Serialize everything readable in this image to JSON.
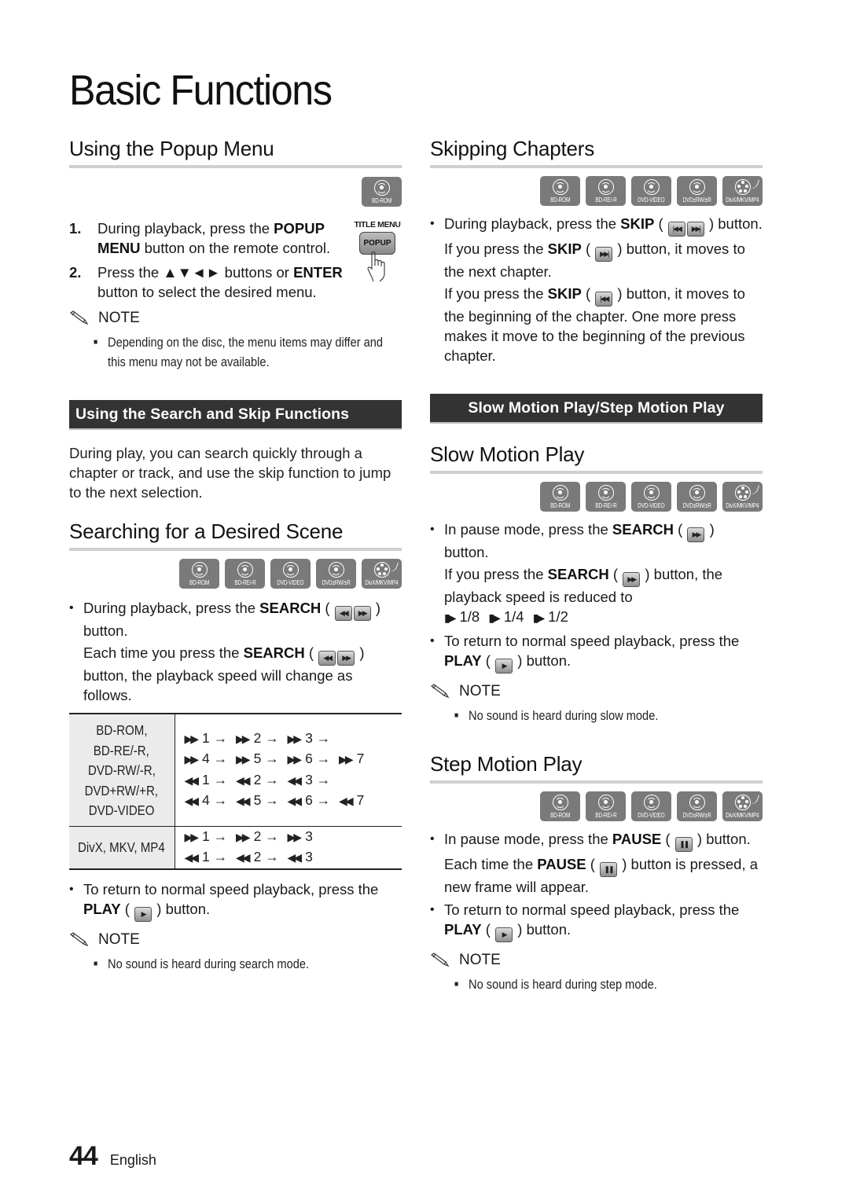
{
  "page": {
    "title": "Basic Functions",
    "page_number": "44",
    "language": "English"
  },
  "disc_badges": [
    "BD-ROM",
    "BD-RE/-R",
    "DVD-VIDEO",
    "DVD±RW/±R",
    "DivX/MKV/MP4"
  ],
  "popup_menu": {
    "heading": "Using the Popup Menu",
    "badge": "BD-ROM",
    "remote_art": {
      "top_label": "TITLE MENU",
      "button_label": "POPUP"
    },
    "steps": [
      {
        "num": "1.",
        "pre": "During playback, press the ",
        "bold": "POPUP MENU",
        "post": " button on the remote control."
      },
      {
        "num": "2.",
        "pre": "Press the ▲▼◄► buttons or ",
        "bold": "ENTER",
        "post": " button to select the desired menu."
      }
    ],
    "note_label": "NOTE",
    "note": "Depending on the disc, the menu items may differ and this menu may not be available."
  },
  "search_skip": {
    "bar_title": "Using the Search and Skip Functions",
    "intro": "During play, you can search quickly through a chapter or track, and use the skip function to jump to the next selection."
  },
  "searching": {
    "heading": "Searching for a Desired Scene",
    "bullet1": {
      "pre": "During playback, press the ",
      "bold": "SEARCH",
      "post": " button."
    },
    "sub1": {
      "pre": "Each time you press the ",
      "bold": "SEARCH",
      "post": " button, the playback speed will change as follows."
    },
    "table": {
      "rows": [
        {
          "discs": [
            "BD-ROM,",
            "BD-RE/-R,",
            "DVD-RW/-R,",
            "DVD+RW/+R,",
            "DVD-VIDEO"
          ],
          "sequences": [
            "1 → 2 → 3 →",
            "4 → 5 → 6 → 7",
            "1 → 2 → 3 →",
            "4 → 5 → 6 → 7"
          ],
          "directions": [
            "ff",
            "ff",
            "rew",
            "rew"
          ]
        },
        {
          "discs": [
            "DivX, MKV, MP4"
          ],
          "sequences": [
            "1 → 2 → 3",
            "1 → 2 → 3"
          ],
          "directions": [
            "ff",
            "rew"
          ]
        }
      ]
    },
    "bullet2": {
      "pre": "To return to normal speed playback, press the ",
      "bold": "PLAY",
      "post": " button."
    },
    "note_label": "NOTE",
    "note": "No sound is heard during search mode."
  },
  "skipping": {
    "heading": "Skipping Chapters",
    "bullet1": {
      "pre": "During playback, press the ",
      "bold": "SKIP",
      "post": " button."
    },
    "sub1": {
      "pre": "If you press the ",
      "bold": "SKIP",
      "post": " button, it moves to the next chapter."
    },
    "sub2": {
      "pre": "If you press the ",
      "bold": "SKIP",
      "post": " button, it moves to the beginning of the chapter. One more press makes it move to the beginning of the previous chapter."
    }
  },
  "slow_step_bar": "Slow Motion Play/Step Motion Play",
  "slow_motion": {
    "heading": "Slow Motion Play",
    "bullet1": {
      "pre": "In pause mode, press the ",
      "bold": "SEARCH",
      "post": " button."
    },
    "sub1": {
      "pre": "If you press the ",
      "bold": "SEARCH",
      "post": " button, the playback speed is reduced to"
    },
    "speeds": [
      "1/8",
      "1/4",
      "1/2"
    ],
    "bullet2": {
      "pre": "To return to normal speed playback, press the ",
      "bold": "PLAY",
      "post": " button."
    },
    "note_label": "NOTE",
    "note": "No sound is heard during slow mode."
  },
  "step_motion": {
    "heading": "Step Motion Play",
    "bullet1": {
      "pre": "In pause mode, press the ",
      "bold": "PAUSE",
      "post": " button."
    },
    "sub1": {
      "pre": "Each time the ",
      "bold": "PAUSE",
      "post": " button is pressed, a new frame will appear."
    },
    "bullet2": {
      "pre": "To return to normal speed playback, press the ",
      "bold": "PLAY",
      "post": " button."
    },
    "note_label": "NOTE",
    "note": "No sound is heard during step mode."
  }
}
